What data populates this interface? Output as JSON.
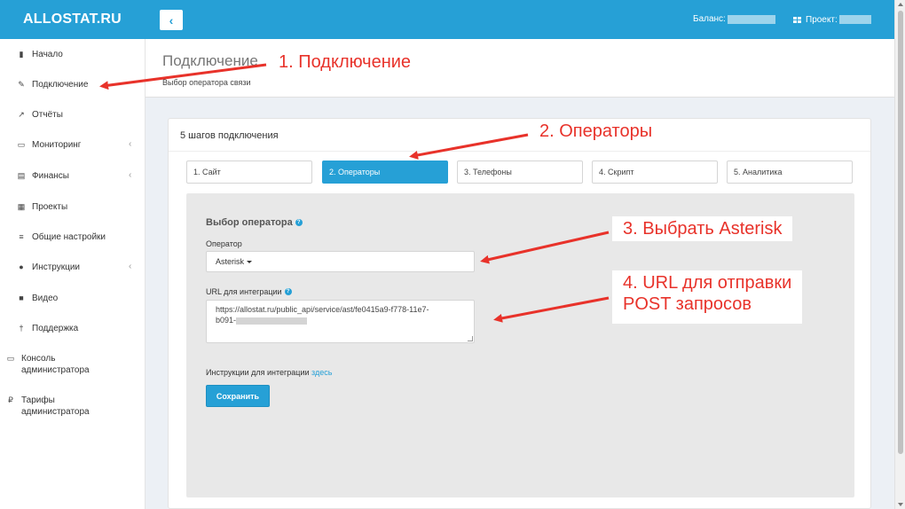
{
  "header": {
    "logo": "ALLOSTAT.RU",
    "toggle_icon": "chevron-left-icon",
    "toggle_glyph": "‹",
    "balance_label": "Баланс:",
    "project_label": "Проект:"
  },
  "sidebar": {
    "items": [
      {
        "label": "Начало",
        "icon": "bookmark-icon",
        "glyph": "▮"
      },
      {
        "label": "Подключение",
        "icon": "plug-icon",
        "glyph": "✎"
      },
      {
        "label": "Отчёты",
        "icon": "line-chart-icon",
        "glyph": "↗"
      },
      {
        "label": "Мониторинг",
        "icon": "desktop-icon",
        "glyph": "▭",
        "chevron": "‹"
      },
      {
        "label": "Финансы",
        "icon": "credit-card-icon",
        "glyph": "▤",
        "chevron": "‹"
      },
      {
        "label": "Проекты",
        "icon": "th-large-icon",
        "glyph": "▦"
      },
      {
        "label": "Общие настройки",
        "icon": "sliders-icon",
        "glyph": "≡"
      },
      {
        "label": "Инструкции",
        "icon": "question-circle-icon",
        "glyph": "●",
        "chevron": "‹"
      },
      {
        "label": "Видео",
        "icon": "video-camera-icon",
        "glyph": "■"
      },
      {
        "label": "Поддержка",
        "icon": "male-icon",
        "glyph": "†"
      },
      {
        "label": "Консоль администратора",
        "icon": "desktop-icon",
        "glyph": "▭"
      },
      {
        "label": "Тарифы администратора",
        "icon": "ruble-icon",
        "glyph": "₽"
      }
    ]
  },
  "page": {
    "title": "Подключение",
    "subtitle": "Выбор оператора связи"
  },
  "card": {
    "title": "5 шагов подключения",
    "steps": [
      {
        "label": "1. Сайт",
        "active": false
      },
      {
        "label": "2. Операторы",
        "active": true
      },
      {
        "label": "3. Телефоны",
        "active": false
      },
      {
        "label": "4. Скрипт",
        "active": false
      },
      {
        "label": "5. Аналитика",
        "active": false
      }
    ],
    "panel": {
      "title": "Выбор оператора",
      "operator_label": "Оператор",
      "operator_value": "Asterisk",
      "url_label": "URL для интеграции",
      "url_value_line1": "https://allostat.ru/public_api/service/ast/fe0415a9-f778-11e7-",
      "url_value_line2": "b091-",
      "instructions_text": "Инструкции для интеграции",
      "instructions_link": "здесь",
      "save_label": "Сохранить"
    }
  },
  "annotations": {
    "a1": "1. Подключение",
    "a2": "2. Операторы",
    "a3": "3. Выбрать Asterisk",
    "a4_line1": "4. URL для отправки",
    "a4_line2": "POST запросов",
    "color": "#e8322a"
  },
  "colors": {
    "brand": "#26a0d6",
    "background": "#ecf0f5"
  }
}
